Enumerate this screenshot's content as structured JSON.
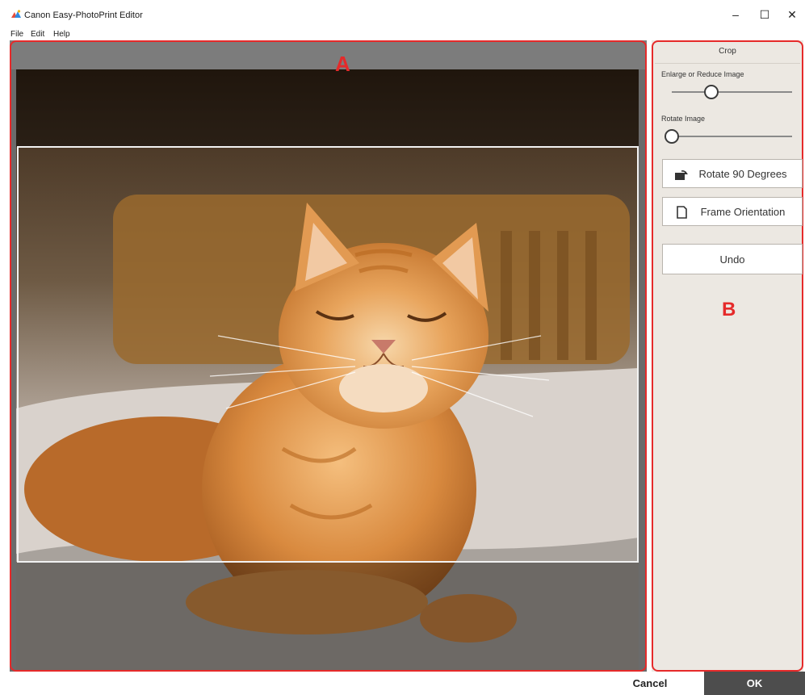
{
  "app": {
    "title": "Canon Easy-PhotoPrint Editor"
  },
  "window_controls": {
    "minimize": "–",
    "maximize": "☐",
    "close": "✕"
  },
  "menu": {
    "file": "File",
    "edit": "Edit",
    "help": "Help"
  },
  "annotations": {
    "a": "A",
    "b": "B",
    "color": "#e52a2a"
  },
  "crop": {
    "title": "Crop",
    "enlarge_label": "Enlarge or Reduce Image",
    "enlarge_value": 0.33,
    "rotate_label": "Rotate Image",
    "rotate_value": 0.0,
    "rotate90_label": "Rotate 90 Degrees",
    "rotate90_icon": "rotate-image-icon",
    "frame_label": "Frame Orientation",
    "frame_icon": "page-icon",
    "undo_label": "Undo"
  },
  "footer": {
    "cancel_label": "Cancel",
    "ok_label": "OK"
  },
  "colors": {
    "panel_bg": "#ece8e2",
    "ok_bg": "#4d4d4d",
    "canvas_bg": "#6b6b6b"
  }
}
